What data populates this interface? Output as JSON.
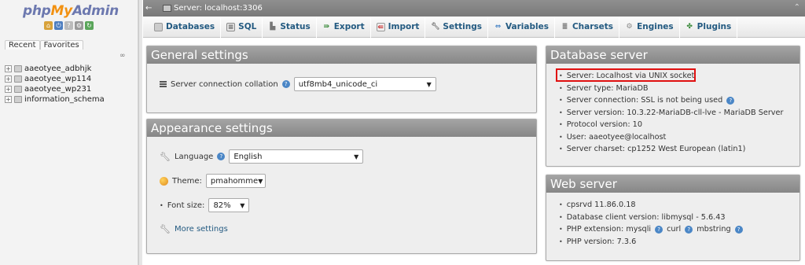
{
  "app": {
    "logo_php": "php",
    "logo_my": "My",
    "logo_admin": "Admin"
  },
  "nav": {
    "tabs": [
      "Recent",
      "Favorites"
    ],
    "databases": [
      "aaeotyee_adbhjk",
      "aaeotyee_wp114",
      "aaeotyee_wp231",
      "information_schema"
    ]
  },
  "serverbar": {
    "title": "Server: localhost:3306"
  },
  "menu": {
    "tabs": [
      {
        "label": "Databases",
        "icon": "database-icon"
      },
      {
        "label": "SQL",
        "icon": "sql-icon"
      },
      {
        "label": "Status",
        "icon": "status-icon"
      },
      {
        "label": "Export",
        "icon": "export-icon"
      },
      {
        "label": "Import",
        "icon": "import-icon"
      },
      {
        "label": "Settings",
        "icon": "wrench-icon"
      },
      {
        "label": "Variables",
        "icon": "variables-icon"
      },
      {
        "label": "Charsets",
        "icon": "charsets-icon"
      },
      {
        "label": "Engines",
        "icon": "engines-icon"
      },
      {
        "label": "Plugins",
        "icon": "plugins-icon"
      }
    ]
  },
  "general": {
    "title": "General settings",
    "collation_label": "Server connection collation",
    "collation_value": "utf8mb4_unicode_ci"
  },
  "appearance": {
    "title": "Appearance settings",
    "language_label": "Language",
    "language_value": "English",
    "theme_label": "Theme:",
    "theme_value": "pmahomme",
    "fontsize_label": "Font size:",
    "fontsize_value": "82%",
    "more_settings": "More settings"
  },
  "dbserver": {
    "title": "Database server",
    "items": [
      "Server: Localhost via UNIX socket",
      "Server type: MariaDB",
      "Server connection: SSL is not being used",
      "Server version: 10.3.22-MariaDB-cll-lve - MariaDB Server",
      "Protocol version: 10",
      "User: aaeotyee@localhost",
      "Server charset: cp1252 West European (latin1)"
    ]
  },
  "webserver": {
    "title": "Web server",
    "items": [
      "cpsrvd 11.86.0.18",
      "Database client version: libmysql - 5.6.43",
      "PHP extension: mysqli",
      "curl",
      "mbstring",
      "PHP version: 7.3.6"
    ]
  },
  "colors": {
    "accent": "#235a81",
    "highlight": "#e01010",
    "header": "#868686"
  }
}
